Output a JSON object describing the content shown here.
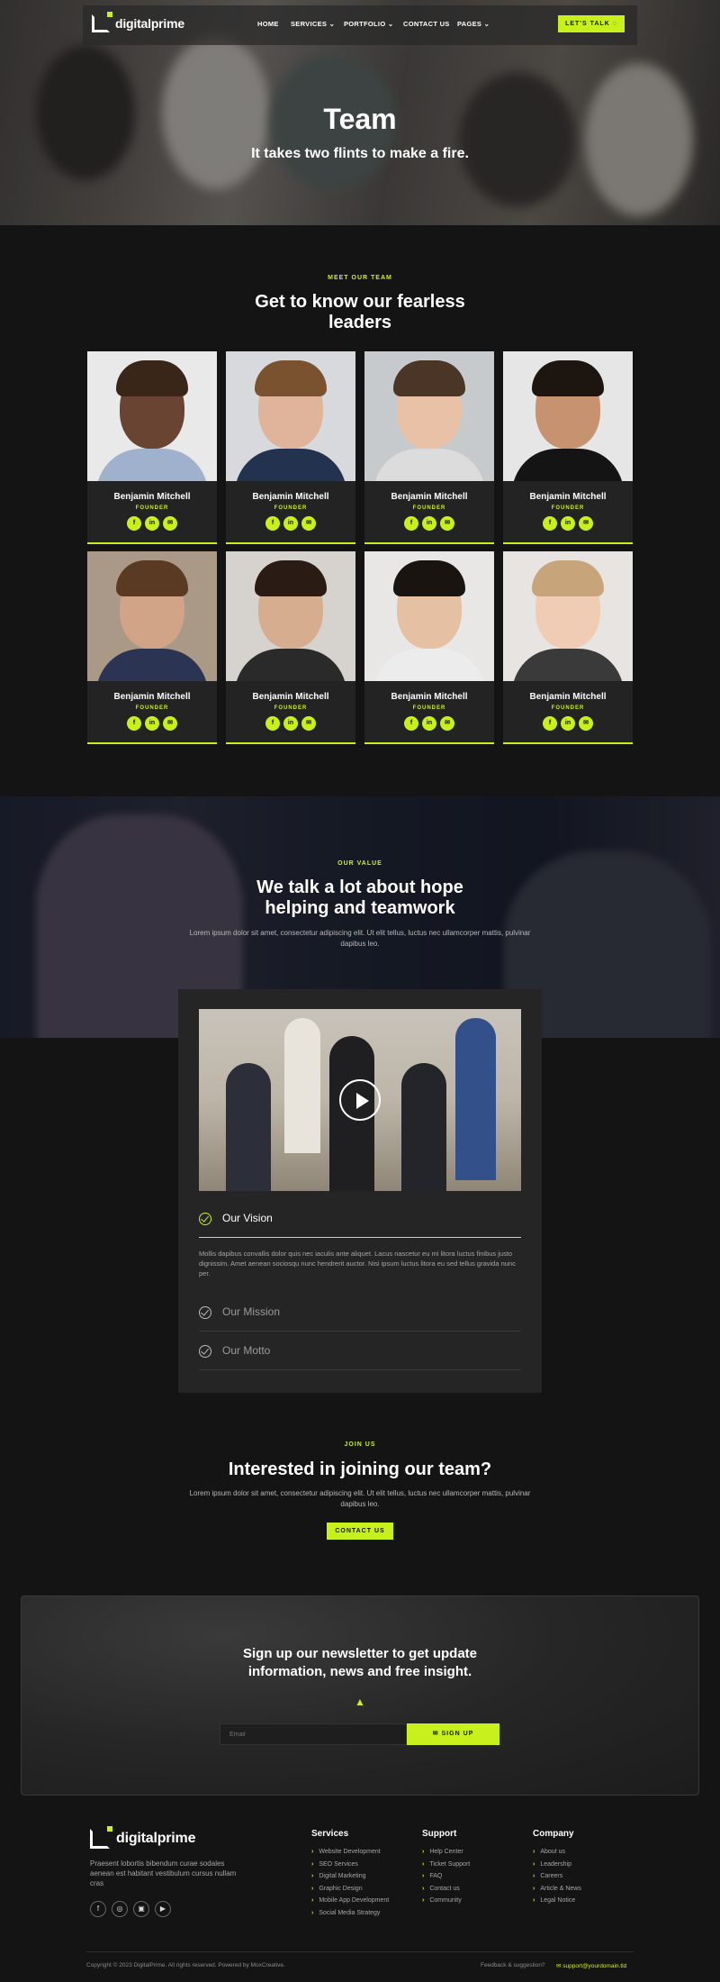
{
  "nav": {
    "logo_text": "digitalprime",
    "items": [
      {
        "label": "HOME"
      },
      {
        "label": "SERVICES"
      },
      {
        "label": "PORTFOLIO"
      },
      {
        "label": "CONTACT US"
      },
      {
        "label": "PAGES"
      }
    ],
    "cta_label": "LET'S TALK"
  },
  "hero": {
    "title": "Team",
    "subtitle": "It takes two flints to make a fire."
  },
  "team": {
    "eyebrow": "MEET OUR TEAM",
    "title_line1": "Get to know our fearless",
    "title_line2": "leaders",
    "members": [
      {
        "name": "Benjamin Mitchell",
        "role": "FOUNDER"
      },
      {
        "name": "Benjamin Mitchell",
        "role": "FOUNDER"
      },
      {
        "name": "Benjamin Mitchell",
        "role": "FOUNDER"
      },
      {
        "name": "Benjamin Mitchell",
        "role": "FOUNDER"
      },
      {
        "name": "Benjamin Mitchell",
        "role": "FOUNDER"
      },
      {
        "name": "Benjamin Mitchell",
        "role": "FOUNDER"
      },
      {
        "name": "Benjamin Mitchell",
        "role": "FOUNDER"
      },
      {
        "name": "Benjamin Mitchell",
        "role": "FOUNDER"
      }
    ]
  },
  "value": {
    "eyebrow": "OUR VALUE",
    "title_line1": "We talk a lot about hope",
    "title_line2": "helping and teamwork",
    "lead": "Lorem ipsum dolor sit amet, consectetur adipiscing elit. Ut elit tellus, luctus nec ullamcorper mattis, pulvinar dapibus leo.",
    "accordion": [
      {
        "label": "Our Vision",
        "text": "Mollis dapibus convallis dolor quis nec iaculis ante aliquet. Lacus nascetur eu mi litora luctus finibus justo dignissim. Amet aenean sociosqu nunc hendrerit auctor. Nisi ipsum luctus litora eu sed tellus gravida nunc per."
      },
      {
        "label": "Our Mission"
      },
      {
        "label": "Our Motto"
      }
    ]
  },
  "join": {
    "eyebrow": "JOIN US",
    "title": "Interested in joining our team?",
    "lead": "Lorem ipsum dolor sit amet, consectetur adipiscing elit. Ut elit tellus, luctus nec ullamcorper mattis, pulvinar dapibus leo.",
    "cta_label": "CONTACT US"
  },
  "newsletter": {
    "title_line1": "Sign up our newsletter to get update",
    "title_line2": "information, news and free insight.",
    "email_placeholder": "Email",
    "button_label": "SIGN UP"
  },
  "footer": {
    "logo_text": "digitalprime",
    "description": "Praesent lobortis bibendum curae sodales aenean est habitant vestibulum cursus nullam cras",
    "columns": [
      {
        "title": "Services",
        "links": [
          "Website Development",
          "SEO Services",
          "Digital Marketing",
          "Graphic Design",
          "Mobile App Development",
          "Social Media Strategy"
        ]
      },
      {
        "title": "Support",
        "links": [
          "Help Center",
          "Ticket Support",
          "FAQ",
          "Contact us",
          "Community"
        ]
      },
      {
        "title": "Company",
        "links": [
          "About us",
          "Leadership",
          "Careers",
          "Article & News",
          "Legal Notice"
        ]
      }
    ],
    "copyright": "Copyright © 2023 DigitalPrime. All rights reserved. Powered by MoxCreative.",
    "feedback": "Feedback & suggestion?",
    "support_email": "support@yourdomain.tld"
  },
  "colors": {
    "accent": "#c8f01c",
    "background": "#141414",
    "card": "#232323"
  }
}
